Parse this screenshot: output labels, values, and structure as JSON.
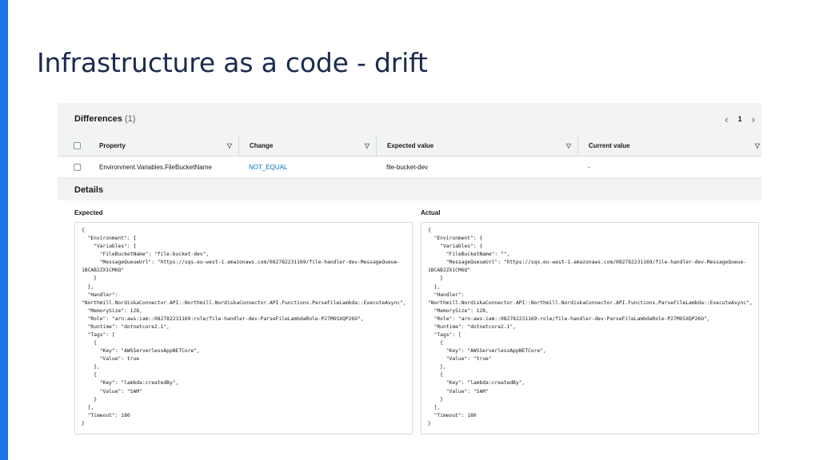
{
  "slide": {
    "title": "Infrastructure as a code - drift"
  },
  "differences": {
    "title": "Differences",
    "count": "(1)",
    "pager": {
      "prev_icon": "chevron-left-icon",
      "page": "1",
      "next_icon": "chevron-right-icon"
    },
    "columns": [
      "Property",
      "Change",
      "Expected value",
      "Current value"
    ],
    "sort_icon": "caret-down-icon",
    "rows": [
      {
        "property": "Environment.Variables.FileBucketName",
        "change": "NOT_EQUAL",
        "expected": "file-bucket-dev",
        "current": "-"
      }
    ]
  },
  "details": {
    "title": "Details",
    "expected_label": "Expected",
    "actual_label": "Actual",
    "expected_json": "{\n  \"Environment\": {\n    \"Variables\": {\n      \"FileBucketName\": \"file-bucket-dev\",\n      \"MessageQueueUrl\": \"https://sqs.eu-west-1.amazonaws.com/082782231169/file-handler-dev-MessageQueue-\n1BCAB2ZX1CM6Q\"\n    }\n  },\n  \"Handler\":\n\"Northmill.NordiskaConnector.API::Northmill.NordiskaConnector.API.Functions.ParseFileLambda::ExecuteAsync\",\n  \"MemorySize\": 128,\n  \"Role\": \"arn:aws:iam::082782231169:role/file-handler-dev-ParseFileLambdaRole-P27MOSXQP26O\",\n  \"Runtime\": \"dotnetcore2.1\",\n  \"Tags\": [\n    {\n      \"Key\": \"AWSServerlessAppNETCore\",\n      \"Value\": true\n    },\n    {\n      \"Key\": \"lambda:createdBy\",\n      \"Value\": \"SAM\"\n    }\n  ],\n  \"Timeout\": 180\n}",
    "actual_json": "{\n  \"Environment\": {\n    \"Variables\": {\n      \"FileBucketName\": \"\",\n      \"MessageQueueUrl\": \"https://sqs.eu-west-1.amazonaws.com/082782231169/file-handler-dev-MessageQueue-\n1BCAB2ZX1CM6Q\"\n    }\n  },\n  \"Handler\":\n\"Northmill.NordiskaConnector.API::Northmill.NordiskaConnector.API.Functions.ParseFileLambda::ExecuteAsync\",\n  \"MemorySize\": 128,\n  \"Role\": \"arn:aws:iam::082782231169:role/file-handler-dev-ParseFileLambdaRole-P27MOSXQP26O\",\n  \"Runtime\": \"dotnetcore2.1\",\n  \"Tags\": [\n    {\n      \"Key\": \"AWSServerlessAppNETCore\",\n      \"Value\": \"true\"\n    },\n    {\n      \"Key\": \"lambda:createdBy\",\n      \"Value\": \"SAM\"\n    }\n  ],\n  \"Timeout\": 180\n}"
  },
  "colors": {
    "accent": "#1a73e8",
    "title": "#1b2a4e",
    "link": "#0073bb",
    "panel_bg": "#f2f3f3"
  }
}
